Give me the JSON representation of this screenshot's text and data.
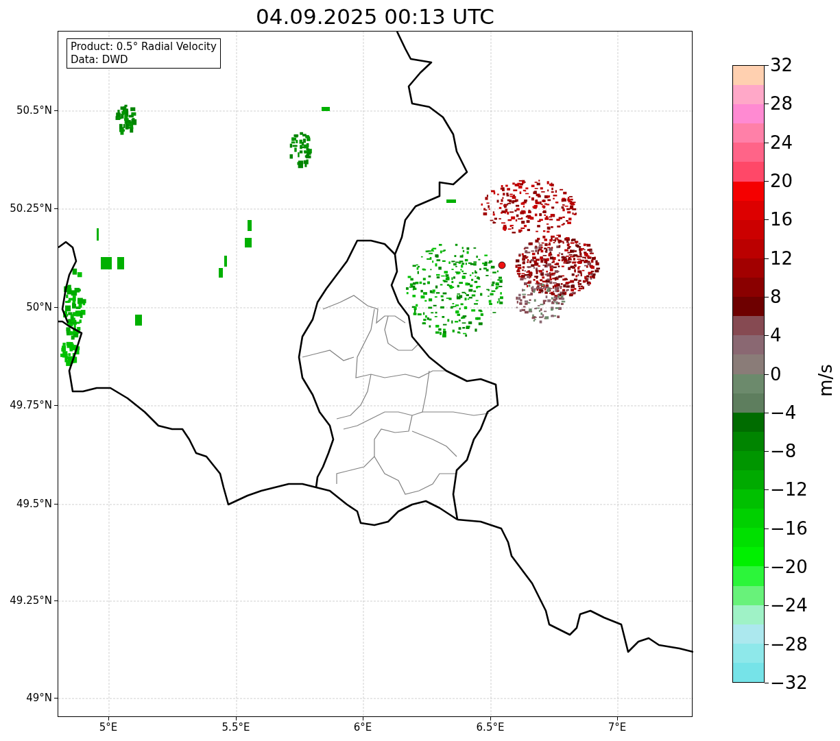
{
  "title": "04.09.2025 00:13 UTC",
  "info_box": {
    "lines": [
      "Product: 0.5° Radial Velocity",
      "Data: DWD"
    ]
  },
  "map": {
    "xticks": [
      "5°E",
      "5.5°E",
      "6°E",
      "6.5°E",
      "7°E"
    ],
    "yticks": [
      "50.5°N",
      "50.25°N",
      "50°N",
      "49.75°N",
      "49.5°N",
      "49.25°N",
      "49°N"
    ]
  },
  "colorbar": {
    "label": "m/s",
    "ticks": [
      "32",
      "28",
      "24",
      "20",
      "16",
      "12",
      "8",
      "4",
      "0",
      "−4",
      "−8",
      "−12",
      "−16",
      "−20",
      "−24",
      "−28",
      "−32"
    ],
    "bins": [
      {
        "color": "#ffd0b0"
      },
      {
        "color": "#ffa8c8"
      },
      {
        "color": "#ff8ad2"
      },
      {
        "color": "#ff80a8"
      },
      {
        "color": "#ff6488"
      },
      {
        "color": "#ff4868"
      },
      {
        "color": "#f50000"
      },
      {
        "color": "#dd0000"
      },
      {
        "color": "#cc0000"
      },
      {
        "color": "#bb0000"
      },
      {
        "color": "#a20000"
      },
      {
        "color": "#8a0000"
      },
      {
        "color": "#6e0000"
      },
      {
        "color": "#864a52"
      },
      {
        "color": "#8a6872"
      },
      {
        "color": "#8a7c78"
      },
      {
        "color": "#6c8a6c"
      },
      {
        "color": "#5e7e5e"
      },
      {
        "color": "#006c00"
      },
      {
        "color": "#008400"
      },
      {
        "color": "#009600"
      },
      {
        "color": "#00aa00"
      },
      {
        "color": "#00c000"
      },
      {
        "color": "#00d000"
      },
      {
        "color": "#00e000"
      },
      {
        "color": "#00f000"
      },
      {
        "color": "#2cf53a"
      },
      {
        "color": "#68f27a"
      },
      {
        "color": "#9ff2c6"
      },
      {
        "color": "#ace8ee"
      },
      {
        "color": "#8ee8ea"
      },
      {
        "color": "#76e3e8"
      }
    ]
  }
}
